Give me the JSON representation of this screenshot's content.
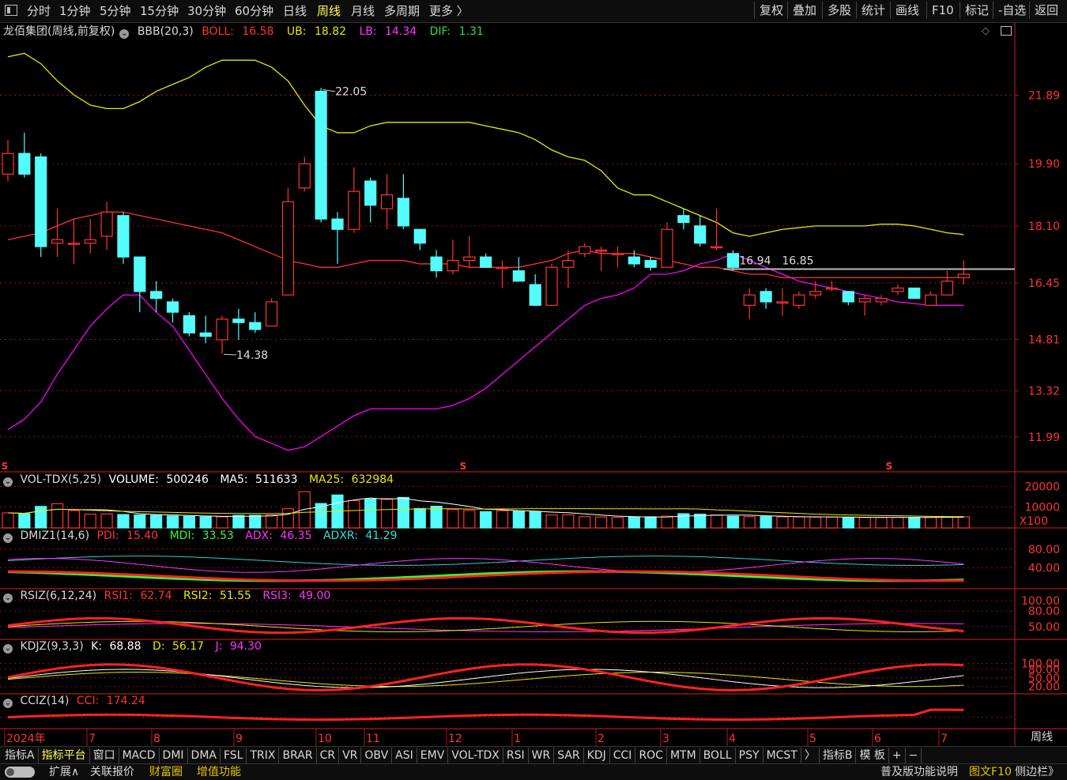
{
  "toolbar": {
    "periods": [
      "分时",
      "1分钟",
      "5分钟",
      "15分钟",
      "30分钟",
      "60分钟",
      "日线",
      "周线",
      "月线",
      "多周期",
      "更多 〉"
    ],
    "active_period": "周线",
    "tools": [
      "复权",
      "叠加",
      "多股",
      "统计",
      "画线",
      "F10",
      "标记",
      "-自选",
      "返回"
    ]
  },
  "main_header": {
    "stock": "龙佰集团(周线,前复权)",
    "indicator": "BBB(20,3)",
    "boll_label": "BOLL:",
    "boll_value": "16.58",
    "ub_label": "UB:",
    "ub_value": "18.82",
    "lb_label": "LB:",
    "lb_value": "14.34",
    "dif_label": "DIF:",
    "dif_value": "1.31"
  },
  "colors": {
    "up": "#ff3333",
    "down": "#54fcfc",
    "mid": "#ff3232",
    "ub": "#e8e800",
    "lb": "#ff00ff",
    "axis": "#b01818",
    "bg": "#000000"
  },
  "annotations": {
    "high": "22.05",
    "low": "14.38",
    "l1": "16.94",
    "l2": "16.85"
  },
  "price_axis_labels": [
    "21.89",
    "19.90",
    "18.10",
    "16.45",
    "14.81",
    "13.32",
    "11.99"
  ],
  "time_axis_labels": [
    "2024年",
    "7",
    "8",
    "9",
    "10",
    "11",
    "12",
    "1",
    "2",
    "3",
    "4",
    "5",
    "6",
    "7"
  ],
  "chart_data": {
    "type": "candlestick",
    "ylim": [
      11.0,
      23.5
    ],
    "candles": [
      {
        "o": 19.6,
        "h": 20.6,
        "l": 19.4,
        "c": 20.2
      },
      {
        "o": 20.2,
        "h": 20.8,
        "l": 19.5,
        "c": 19.6
      },
      {
        "o": 20.1,
        "h": 20.2,
        "l": 17.2,
        "c": 17.5
      },
      {
        "o": 17.6,
        "h": 18.6,
        "l": 17.2,
        "c": 17.7
      },
      {
        "o": 17.6,
        "h": 18.3,
        "l": 17.0,
        "c": 17.6
      },
      {
        "o": 17.6,
        "h": 18.3,
        "l": 17.3,
        "c": 17.7
      },
      {
        "o": 17.8,
        "h": 18.8,
        "l": 17.4,
        "c": 18.5
      },
      {
        "o": 18.4,
        "h": 18.5,
        "l": 17.0,
        "c": 17.2
      },
      {
        "o": 17.2,
        "h": 17.2,
        "l": 15.6,
        "c": 16.2
      },
      {
        "o": 16.2,
        "h": 16.5,
        "l": 15.6,
        "c": 16.0
      },
      {
        "o": 15.9,
        "h": 16.0,
        "l": 15.3,
        "c": 15.6
      },
      {
        "o": 15.5,
        "h": 15.6,
        "l": 14.9,
        "c": 15.0
      },
      {
        "o": 15.0,
        "h": 15.5,
        "l": 14.7,
        "c": 14.9
      },
      {
        "o": 14.8,
        "h": 15.5,
        "l": 14.4,
        "c": 15.4
      },
      {
        "o": 15.4,
        "h": 15.7,
        "l": 14.8,
        "c": 15.3
      },
      {
        "o": 15.3,
        "h": 15.6,
        "l": 15.0,
        "c": 15.1
      },
      {
        "o": 15.2,
        "h": 16.0,
        "l": 15.2,
        "c": 15.9
      },
      {
        "o": 16.1,
        "h": 19.2,
        "l": 16.1,
        "c": 18.8
      },
      {
        "o": 19.2,
        "h": 20.1,
        "l": 19.1,
        "c": 19.9
      },
      {
        "o": 22.0,
        "h": 22.1,
        "l": 18.2,
        "c": 18.3
      },
      {
        "o": 18.3,
        "h": 18.5,
        "l": 17.0,
        "c": 18.0
      },
      {
        "o": 18.0,
        "h": 19.8,
        "l": 17.9,
        "c": 19.1
      },
      {
        "o": 19.4,
        "h": 19.5,
        "l": 18.2,
        "c": 18.7
      },
      {
        "o": 18.6,
        "h": 19.6,
        "l": 18.0,
        "c": 19.0
      },
      {
        "o": 18.9,
        "h": 19.6,
        "l": 18.0,
        "c": 18.1
      },
      {
        "o": 18.0,
        "h": 18.0,
        "l": 17.4,
        "c": 17.6
      },
      {
        "o": 17.2,
        "h": 17.4,
        "l": 16.6,
        "c": 16.8
      },
      {
        "o": 16.8,
        "h": 17.7,
        "l": 16.7,
        "c": 17.1
      },
      {
        "o": 17.1,
        "h": 17.8,
        "l": 16.9,
        "c": 17.2
      },
      {
        "o": 17.2,
        "h": 17.3,
        "l": 16.9,
        "c": 16.9
      },
      {
        "o": 16.9,
        "h": 17.1,
        "l": 16.3,
        "c": 16.9
      },
      {
        "o": 16.8,
        "h": 17.2,
        "l": 16.5,
        "c": 16.5
      },
      {
        "o": 16.4,
        "h": 16.7,
        "l": 15.8,
        "c": 15.8
      },
      {
        "o": 15.8,
        "h": 17.0,
        "l": 15.8,
        "c": 16.9
      },
      {
        "o": 16.9,
        "h": 17.4,
        "l": 16.3,
        "c": 17.1
      },
      {
        "o": 17.3,
        "h": 17.6,
        "l": 17.2,
        "c": 17.5
      },
      {
        "o": 17.4,
        "h": 17.5,
        "l": 16.8,
        "c": 17.4
      },
      {
        "o": 17.3,
        "h": 17.5,
        "l": 16.9,
        "c": 17.3
      },
      {
        "o": 17.2,
        "h": 17.4,
        "l": 16.9,
        "c": 17.0
      },
      {
        "o": 17.1,
        "h": 17.2,
        "l": 16.8,
        "c": 16.9
      },
      {
        "o": 16.9,
        "h": 18.2,
        "l": 16.9,
        "c": 18.0
      },
      {
        "o": 18.4,
        "h": 18.6,
        "l": 18.0,
        "c": 18.2
      },
      {
        "o": 18.1,
        "h": 18.4,
        "l": 17.5,
        "c": 17.6
      },
      {
        "o": 17.5,
        "h": 18.6,
        "l": 17.4,
        "c": 17.5
      },
      {
        "o": 17.3,
        "h": 17.4,
        "l": 16.8,
        "c": 16.9
      },
      {
        "o": 15.8,
        "h": 16.3,
        "l": 15.4,
        "c": 16.1
      },
      {
        "o": 16.2,
        "h": 16.3,
        "l": 15.7,
        "c": 15.9
      },
      {
        "o": 15.9,
        "h": 16.3,
        "l": 15.5,
        "c": 15.9
      },
      {
        "o": 15.8,
        "h": 16.2,
        "l": 15.7,
        "c": 16.1
      },
      {
        "o": 16.1,
        "h": 16.5,
        "l": 16.0,
        "c": 16.2
      },
      {
        "o": 16.3,
        "h": 16.5,
        "l": 16.2,
        "c": 16.3
      },
      {
        "o": 16.2,
        "h": 16.2,
        "l": 15.8,
        "c": 15.9
      },
      {
        "o": 15.9,
        "h": 16.1,
        "l": 15.5,
        "c": 16.0
      },
      {
        "o": 15.9,
        "h": 16.1,
        "l": 15.8,
        "c": 16.0
      },
      {
        "o": 16.2,
        "h": 16.4,
        "l": 16.1,
        "c": 16.3
      },
      {
        "o": 16.3,
        "h": 16.3,
        "l": 16.0,
        "c": 16.0
      },
      {
        "o": 15.8,
        "h": 16.2,
        "l": 15.8,
        "c": 16.1
      },
      {
        "o": 16.1,
        "h": 16.8,
        "l": 16.1,
        "c": 16.5
      },
      {
        "o": 16.6,
        "h": 17.1,
        "l": 16.4,
        "c": 16.7
      }
    ],
    "boll_mid": [
      17.7,
      17.8,
      17.9,
      18.1,
      18.3,
      18.4,
      18.5,
      18.5,
      18.4,
      18.3,
      18.2,
      18.1,
      18.0,
      17.9,
      17.7,
      17.5,
      17.3,
      17.1,
      17.0,
      16.9,
      16.9,
      17.0,
      17.1,
      17.1,
      17.1,
      17.0,
      17.0,
      17.0,
      16.9,
      16.9,
      16.9,
      16.9,
      17.0,
      17.1,
      17.3,
      17.4,
      17.3,
      17.3,
      17.3,
      17.2,
      17.1,
      17.0,
      16.9,
      16.9,
      16.8,
      16.7,
      16.7,
      16.6,
      16.6,
      16.6,
      16.6,
      16.6,
      16.6,
      16.6,
      16.6,
      16.6,
      16.6,
      16.6,
      16.6
    ],
    "boll_ub": [
      23.0,
      23.1,
      22.8,
      22.3,
      21.9,
      21.6,
      21.5,
      21.5,
      21.7,
      22.0,
      22.2,
      22.4,
      22.7,
      22.9,
      22.9,
      22.9,
      22.7,
      22.3,
      21.6,
      21.0,
      20.8,
      20.8,
      21.0,
      21.1,
      21.1,
      21.1,
      21.1,
      21.1,
      21.1,
      21.0,
      20.9,
      20.8,
      20.6,
      20.3,
      20.1,
      20.0,
      19.7,
      19.2,
      19.0,
      19.0,
      18.8,
      18.6,
      18.4,
      18.2,
      17.9,
      17.8,
      17.9,
      18.0,
      18.05,
      18.1,
      18.1,
      18.1,
      18.1,
      18.15,
      18.15,
      18.1,
      18.0,
      17.9,
      17.85
    ],
    "boll_lb": [
      12.2,
      12.5,
      13.0,
      13.8,
      14.5,
      15.2,
      15.7,
      16.1,
      16.1,
      15.6,
      15.2,
      14.5,
      13.8,
      13.1,
      12.5,
      12.0,
      11.8,
      11.6,
      11.7,
      12.0,
      12.3,
      12.6,
      12.8,
      12.8,
      12.8,
      12.8,
      12.8,
      12.9,
      13.1,
      13.4,
      13.8,
      14.2,
      14.6,
      15.0,
      15.4,
      15.8,
      16.0,
      16.1,
      16.3,
      16.7,
      16.7,
      16.8,
      17.0,
      17.1,
      17.3,
      17.1,
      16.9,
      16.7,
      16.5,
      16.4,
      16.3,
      16.2,
      16.1,
      16.0,
      15.9,
      15.85,
      15.8,
      15.8,
      15.8
    ]
  },
  "vol": {
    "header": {
      "name": "VOL-TDX(5,25)",
      "vol_label": "VOLUME:",
      "vol_value": "500246",
      "ma5_label": "MA5:",
      "ma5_value": "511633",
      "ma25_label": "MA25:",
      "ma25_value": "632984"
    },
    "axis": [
      "20000",
      "10000",
      "X100"
    ],
    "values": [
      7200,
      6800,
      10300,
      11600,
      8300,
      6600,
      6700,
      6400,
      6200,
      6000,
      5700,
      5500,
      5300,
      5300,
      6000,
      6000,
      6200,
      9200,
      17400,
      11700,
      15800,
      13100,
      13800,
      14100,
      14600,
      9300,
      10400,
      8800,
      8400,
      7800,
      8200,
      8100,
      7700,
      6200,
      6300,
      5400,
      5200,
      5000,
      5200,
      5300,
      5600,
      6800,
      6600,
      6200,
      5600,
      5400,
      5400,
      5300,
      5300,
      5200,
      5200,
      5000,
      5000,
      5000,
      5100,
      5000,
      5100,
      5200,
      5300
    ]
  },
  "dmi": {
    "header": {
      "name": "DMIZ1(14,6)",
      "pdi_label": "PDI:",
      "pdi_value": "15.40",
      "mdi_label": "MDI:",
      "mdi_value": "33.53",
      "adx_label": "ADX:",
      "adx_value": "46.35",
      "adxr_label": "ADXR:",
      "adxr_value": "41.29"
    },
    "axis": [
      "80.00",
      "40.00"
    ]
  },
  "rsi": {
    "header": {
      "name": "RSIZ(6,12,24)",
      "r1_label": "RSI1:",
      "r1_value": "62.74",
      "r2_label": "RSI2:",
      "r2_value": "51.55",
      "r3_label": "RSI3:",
      "r3_value": "49.00"
    },
    "axis": [
      "100.00",
      "80.00",
      "50.00"
    ]
  },
  "kdj": {
    "header": {
      "name": "KDJZ(9,3,3)",
      "k_label": "K:",
      "k_value": "68.88",
      "d_label": "D:",
      "d_value": "56.17",
      "j_label": "J:",
      "j_value": "94.30"
    },
    "axis": [
      "100.00",
      "80.00",
      "50.00",
      "20.00"
    ]
  },
  "cci": {
    "header": {
      "name": "CCIZ(14)",
      "cci_label": "CCI:",
      "cci_value": "174.24"
    }
  },
  "bottom_tabs": [
    "指标A",
    "指标平台",
    "窗口",
    "MACD",
    "DMI",
    "DMA",
    "FSL",
    "TRIX",
    "BRAR",
    "CR",
    "VR",
    "OBV",
    "ASI",
    "EMV",
    "VOL-TDX",
    "RSI",
    "WR",
    "SAR",
    "KDJ",
    "CCI",
    "ROC",
    "MTM",
    "BOLL",
    "PSY",
    "MCST",
    "〉",
    "指标B",
    "模 板",
    "+",
    "−"
  ],
  "period_label": "周线",
  "status_items": [
    "扩展∧",
    "关联报价",
    "财富圈",
    "增值功能",
    "普及版功能说明",
    "图文F10",
    "侧边栏》"
  ]
}
